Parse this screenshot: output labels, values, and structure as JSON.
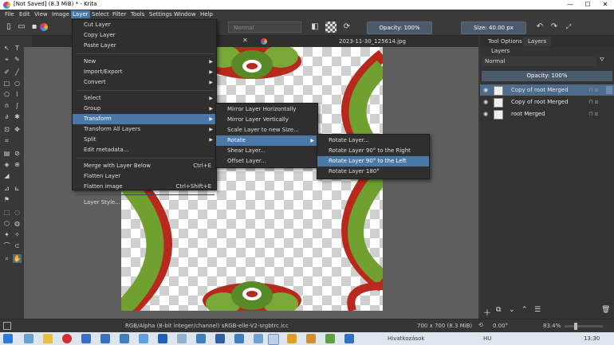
{
  "window": {
    "title": "[Not Saved]  (8.3 MiB)  * - Krita",
    "minimize": "—",
    "maximize": "☐",
    "close": "✕"
  },
  "menubar": [
    "File",
    "Edit",
    "View",
    "Image",
    "Layer",
    "Select",
    "Filter",
    "Tools",
    "Settings",
    "Window",
    "Help"
  ],
  "toolbar": {
    "blend_mode": "Normal",
    "opacity": "Opacity: 100%",
    "size": "Size: 40.00 px"
  },
  "tab": {
    "title": "2023-11-30_125614.jpg",
    "close": "✕"
  },
  "docker": {
    "tabs": [
      "Tool Options",
      "Layers"
    ],
    "header": "Layers",
    "blend_mode": "Normal",
    "opacity": "Opacity:  100%",
    "layers": [
      {
        "name": "Copy of root Merged",
        "selected": true
      },
      {
        "name": "Copy of root Merged",
        "selected": false
      },
      {
        "name": "root Merged",
        "selected": false
      }
    ]
  },
  "layer_menu": [
    {
      "label": "Cut Layer"
    },
    {
      "label": "Copy Layer"
    },
    {
      "label": "Paste Layer"
    },
    {
      "sep": true
    },
    {
      "label": "New",
      "sub": true
    },
    {
      "label": "Import/Export",
      "sub": true
    },
    {
      "label": "Convert",
      "sub": true
    },
    {
      "sep": true
    },
    {
      "label": "Select",
      "sub": true
    },
    {
      "label": "Group",
      "sub": true
    },
    {
      "label": "Transform",
      "sub": true,
      "hi": true
    },
    {
      "label": "Transform All Layers",
      "sub": true
    },
    {
      "label": "Split",
      "sub": true
    },
    {
      "label": "Edit metadata..."
    },
    {
      "sep": true
    },
    {
      "label": "Merge with Layer Below",
      "shortcut": "Ctrl+E"
    },
    {
      "label": "Flatten Layer"
    },
    {
      "label": "Flatten image",
      "shortcut": "Ctrl+Shift+E"
    },
    {
      "sep": true
    },
    {
      "label": "Layer Style..."
    }
  ],
  "transform_menu": [
    {
      "label": "Mirror Layer Horizontally"
    },
    {
      "label": "Mirror Layer Vertically"
    },
    {
      "label": "Scale Layer to new Size..."
    },
    {
      "label": "Rotate",
      "sub": true,
      "hi": true
    },
    {
      "label": "Shear Layer..."
    },
    {
      "label": "Offset Layer..."
    }
  ],
  "rotate_menu": [
    {
      "label": "Rotate Layer..."
    },
    {
      "label": "Rotate Layer 90° to the Right"
    },
    {
      "label": "Rotate Layer 90° to the Left",
      "hi": true
    },
    {
      "label": "Rotate Layer 180°"
    }
  ],
  "status": {
    "color_space": "RGB/Alpha (8-bit integer/channel)  sRGB-elle-V2-srgbtrc.icc",
    "dimensions": "700 x 700 (8.3 MiB)",
    "rotation": "0.00°",
    "zoom": "83.4%"
  },
  "taskbar": {
    "label": "Hivatkozások",
    "lang": "HU",
    "time": "13:30"
  },
  "colors": {
    "accent": "#4a78a8",
    "layer_selected": "#4d6b8a",
    "red": "#b8281c",
    "green": "#6fa030"
  }
}
